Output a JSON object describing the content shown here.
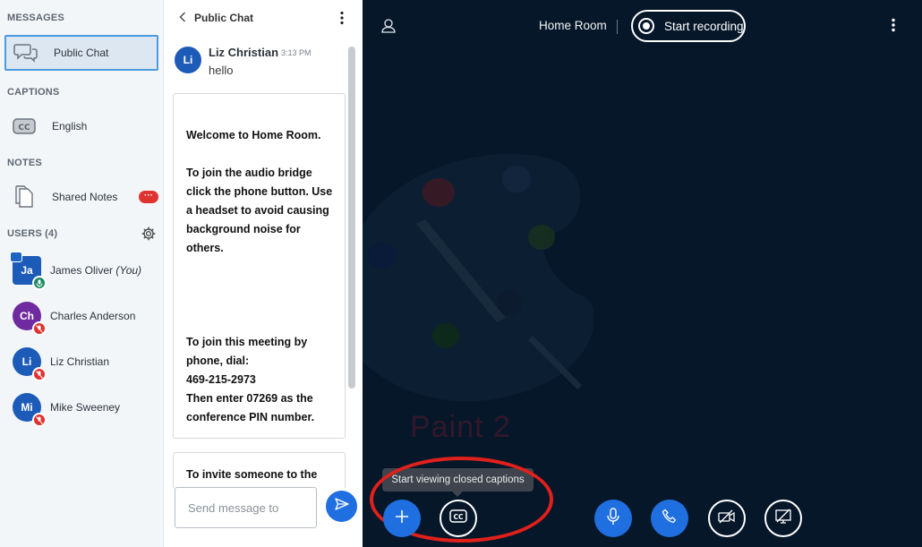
{
  "sidebar": {
    "messages_title": "MESSAGES",
    "public_chat_label": "Public Chat",
    "captions_title": "CAPTIONS",
    "captions_item_label": "English",
    "notes_title": "NOTES",
    "shared_notes_label": "Shared Notes",
    "notes_badge": "···",
    "users_title": "USERS (4)",
    "users": [
      {
        "initials": "Ja",
        "name": "James Oliver",
        "suffix": "(You)",
        "color": "#1d5bb9",
        "mic": "on"
      },
      {
        "initials": "Ch",
        "name": "Charles Anderson",
        "suffix": "",
        "color": "#6e2a9e",
        "mic": "muted"
      },
      {
        "initials": "Li",
        "name": "Liz Christian",
        "suffix": "",
        "color": "#1d5bb9",
        "mic": "muted"
      },
      {
        "initials": "Mi",
        "name": "Mike Sweeney",
        "suffix": "",
        "color": "#1d5bb9",
        "mic": "muted"
      }
    ]
  },
  "chat": {
    "title": "Public Chat",
    "message": {
      "initials": "Li",
      "name": "Liz Christian",
      "time": "3:13 PM",
      "text": "hello"
    },
    "welcome_line_prefix": "Welcome to ",
    "welcome_room": "Home Room.",
    "audio_text": "To join the audio bridge click the phone button. Use a headset to avoid causing background noise for others.",
    "phone_text_1": "To join this meeting by phone, dial:",
    "phone_number": "469-215-2973",
    "phone_text_2": "Then enter 07269 as the conference PIN number.",
    "invite_text": "To invite someone to the",
    "input_placeholder": "Send message to"
  },
  "main": {
    "room_name": "Home Room",
    "record_label": "Start recording",
    "slide_caption": "Paint 2",
    "tooltip": "Start viewing closed captions"
  },
  "colors": {
    "accent": "#1f6fe0",
    "background": "#06172A",
    "highlight": "#e0201a",
    "muted_badge": "#e0332f",
    "mic_on_badge": "#1a8a5e"
  },
  "icons": {
    "chat": "speech-bubbles-icon",
    "captions": "cc-icon",
    "notes": "document-icon",
    "settings": "gear-icon",
    "actions": "plus-icon",
    "microphone": "microphone-icon",
    "phone": "phone-icon",
    "camera": "camera-off-icon",
    "screenshare": "screenshare-off-icon"
  }
}
